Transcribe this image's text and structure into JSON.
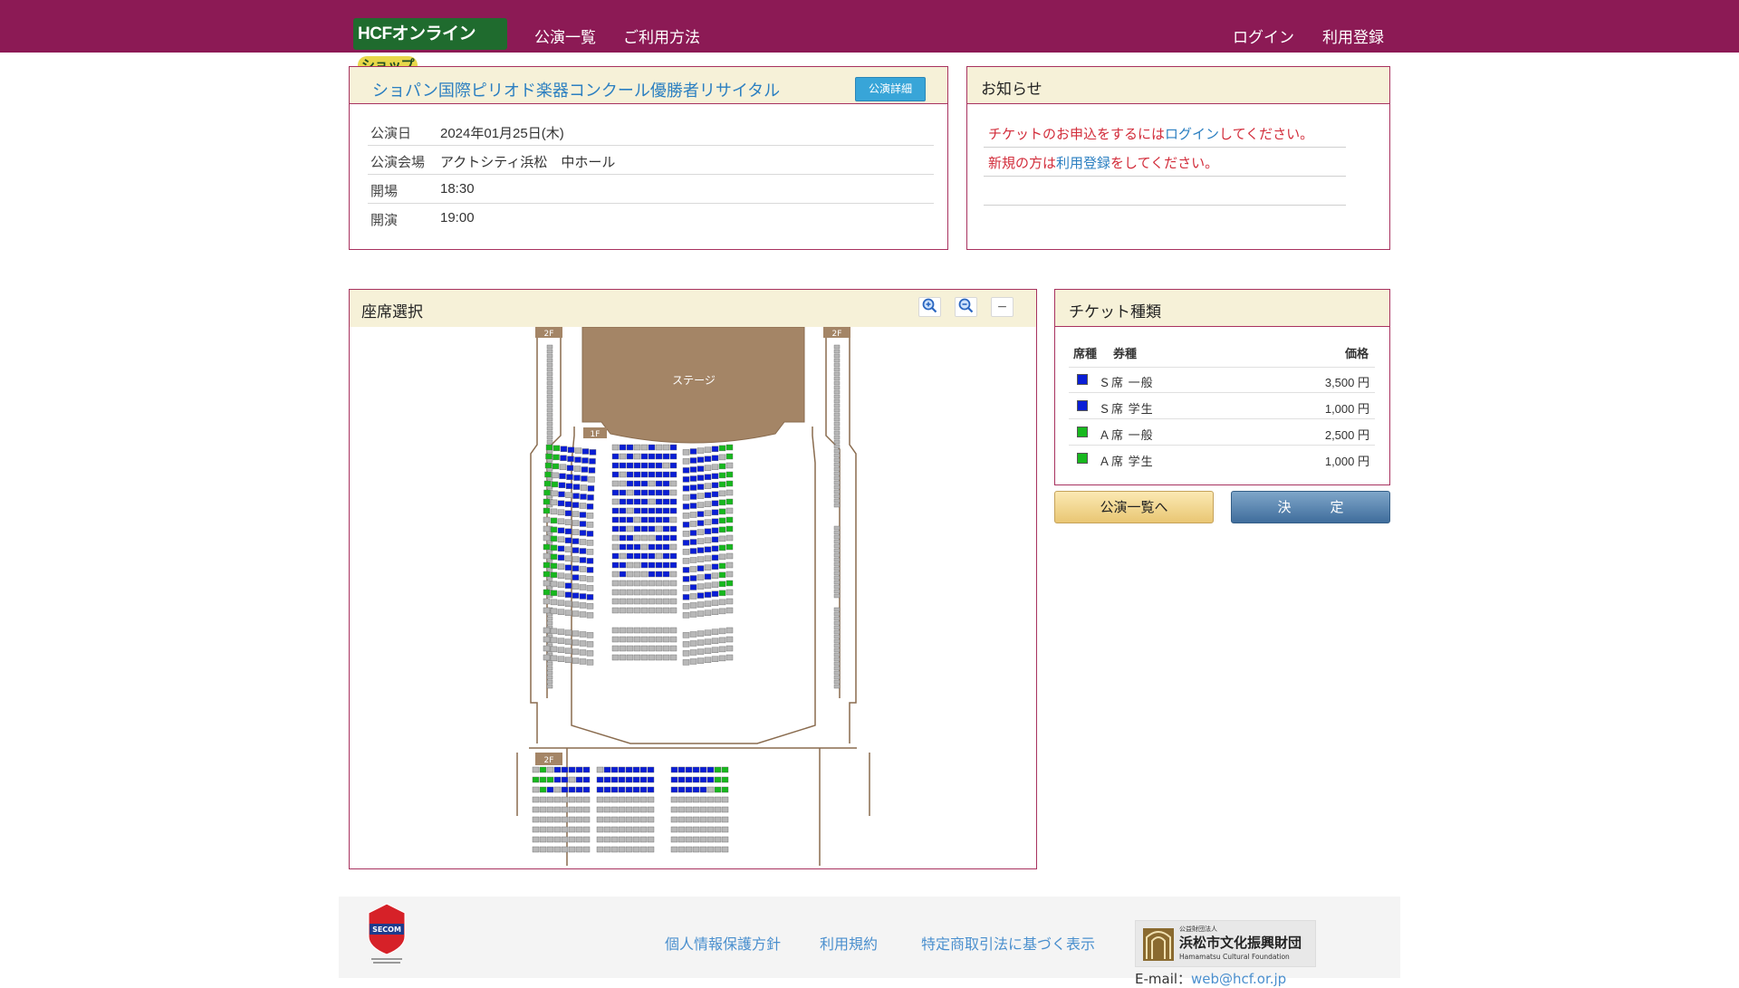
{
  "header": {
    "logo_text": "HCFオンライン",
    "logo_shop": "ショップ",
    "nav_left": [
      "公演一覧",
      "ご利用方法"
    ],
    "nav_right": [
      "ログイン",
      "利用登録"
    ]
  },
  "event": {
    "title": "ショパン国際ピリオド楽器コンクール優勝者リサイタル",
    "detail_button": "公演詳細",
    "rows": [
      {
        "label": "公演日",
        "value": "2024年01月25日(木)"
      },
      {
        "label": "公演会場",
        "value": "アクトシティ浜松　中ホール"
      },
      {
        "label": "開場",
        "value": "18:30"
      },
      {
        "label": "開演",
        "value": "19:00"
      }
    ]
  },
  "notice": {
    "title": "お知らせ",
    "line1_pre": "チケットのお申込をするには",
    "line1_link": "ログイン",
    "line1_post": "してください。",
    "line2_pre": "新規の方は",
    "line2_link": "利用登録",
    "line2_post": "をしてください。"
  },
  "seat_map": {
    "title": "座席選択",
    "zoom_in_icon": "zoom-in-icon",
    "zoom_out_icon": "zoom-out-icon",
    "reset_icon": "minus-icon",
    "stage_label": "ステージ",
    "floor_labels": [
      "2F",
      "2F",
      "1F",
      "2F"
    ],
    "colors": {
      "s_seat": "#0a1ed6",
      "a_seat": "#17b81e",
      "sold": "#b8b8b8"
    }
  },
  "tickets": {
    "title": "チケット種類",
    "col_seat": "席種",
    "col_type": "券種",
    "col_price": "価格",
    "rows": [
      {
        "name": "Ｓ席 一般",
        "price": "3,500 円",
        "color": "#0a1ed6"
      },
      {
        "name": "Ｓ席 学生",
        "price": "1,000 円",
        "color": "#0a1ed6"
      },
      {
        "name": "Ａ席 一般",
        "price": "2,500 円",
        "color": "#17b81e"
      },
      {
        "name": "Ａ席 学生",
        "price": "1,000 円",
        "color": "#17b81e"
      }
    ],
    "back_button": "公演一覧へ",
    "ok_button": "決　定"
  },
  "footer": {
    "links": [
      "個人情報保護方針",
      "利用規約",
      "特定商取引法に基づく表示"
    ],
    "secom_text": "SECOM",
    "hcf_small": "公益財団法人",
    "hcf_name": "浜松市文化振興財団",
    "hcf_en": "Hamamatsu Cultural Foundation",
    "email_label": "E-mail：",
    "email": "web@hcf.or.jp"
  }
}
